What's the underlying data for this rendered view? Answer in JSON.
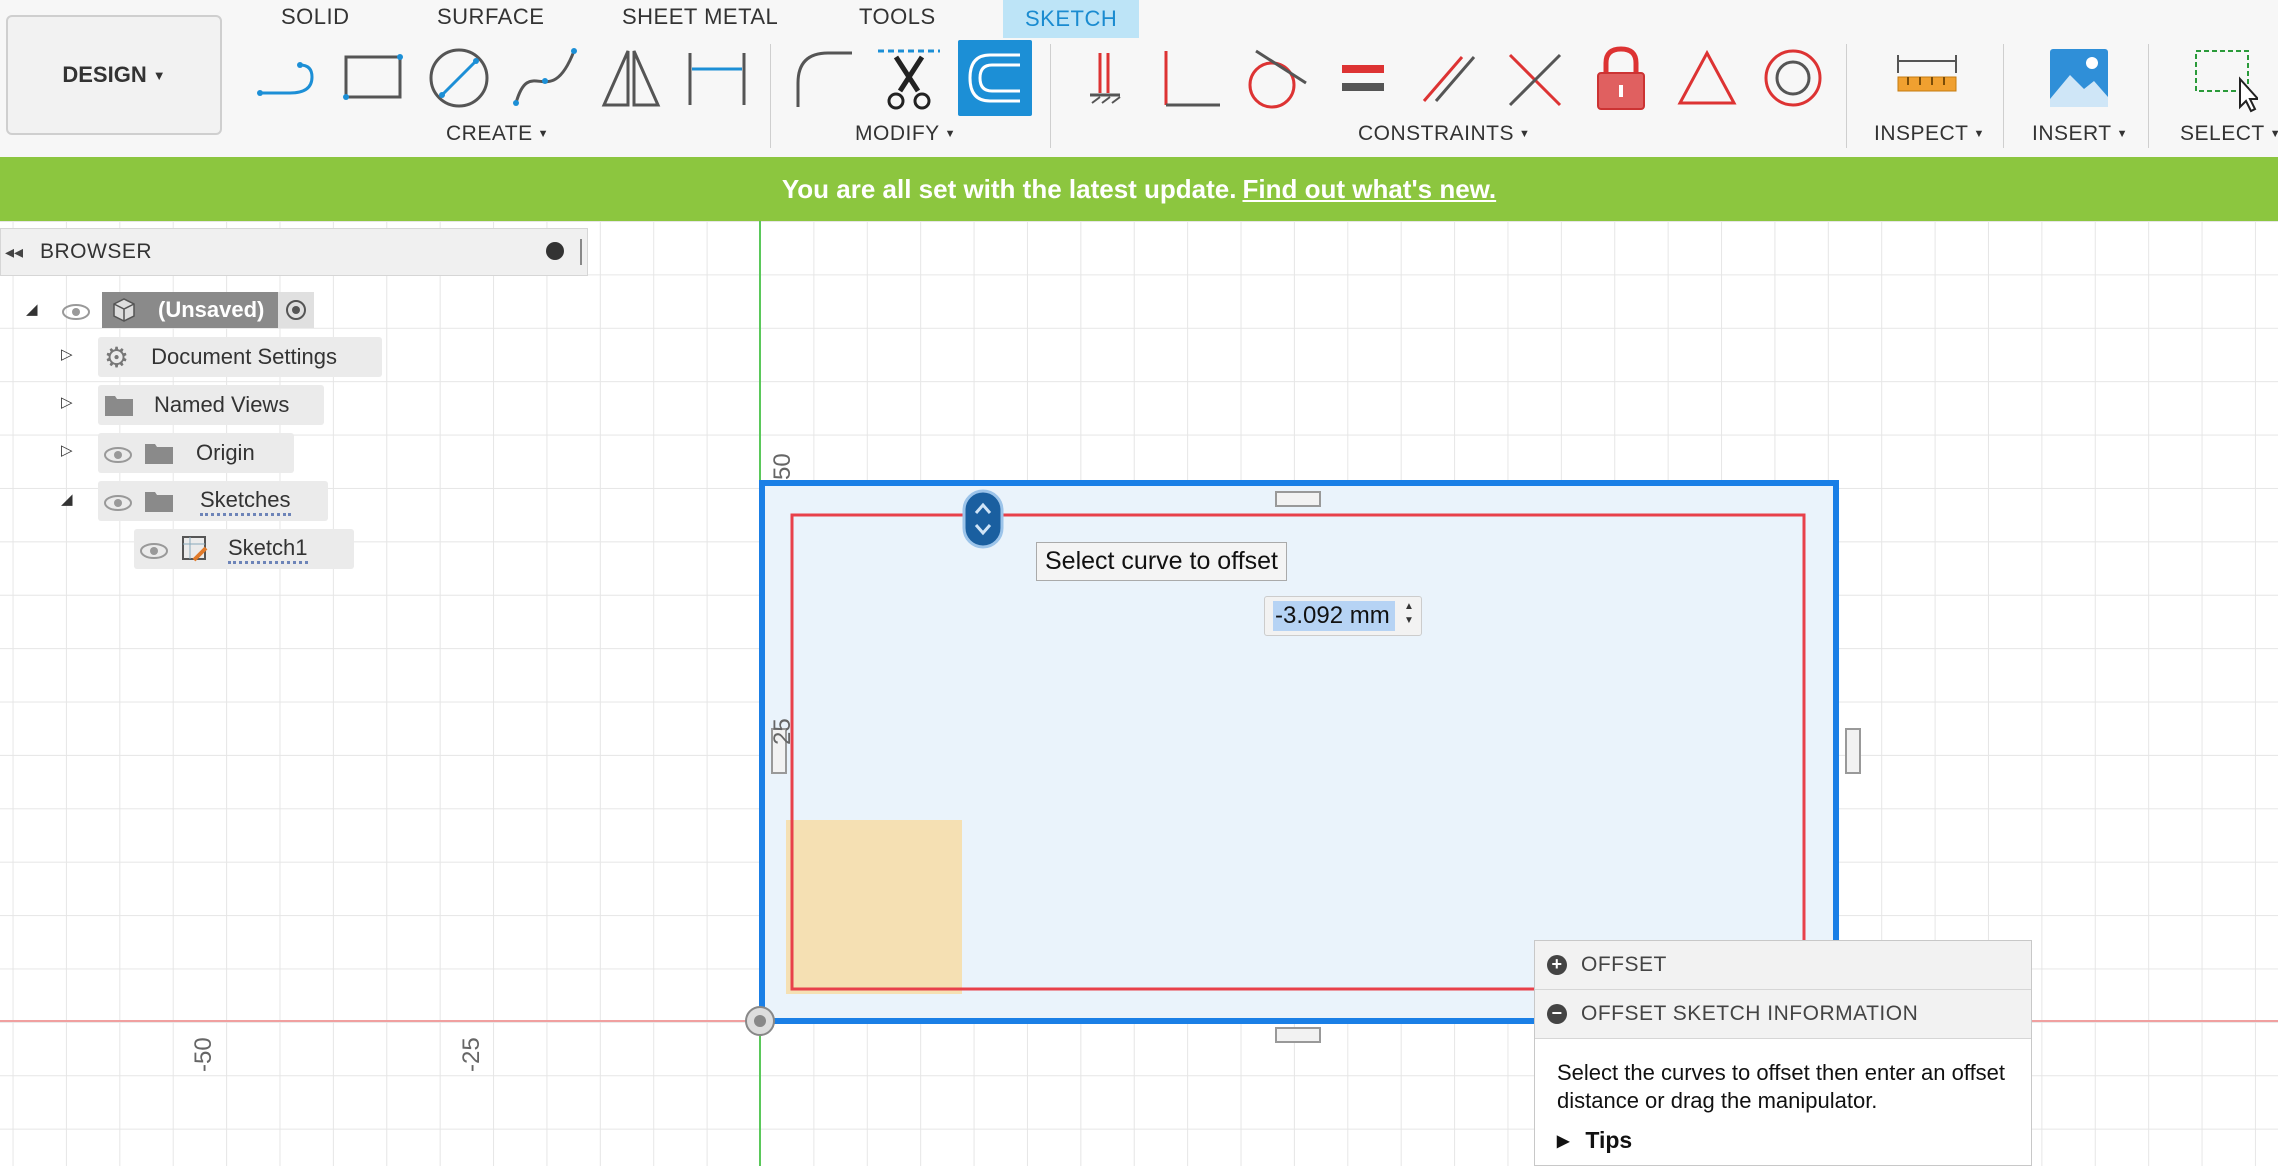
{
  "workspace": {
    "label": "DESIGN"
  },
  "tabs": [
    {
      "label": "SOLID"
    },
    {
      "label": "SURFACE"
    },
    {
      "label": "SHEET METAL"
    },
    {
      "label": "TOOLS"
    },
    {
      "label": "SKETCH",
      "active": true
    }
  ],
  "groups": {
    "create": "CREATE",
    "modify": "MODIFY",
    "constraints": "CONSTRAINTS",
    "inspect": "INSPECT",
    "insert": "INSERT",
    "select": "SELECT"
  },
  "banner": {
    "text": "You are all set with the latest update.",
    "link": "Find out what's new."
  },
  "browser": {
    "title": "BROWSER",
    "items": [
      {
        "label": "(Unsaved)",
        "icon": "component-icon"
      },
      {
        "label": "Document Settings",
        "icon": "gear-icon"
      },
      {
        "label": "Named Views",
        "icon": "folder-icon"
      },
      {
        "label": "Origin",
        "icon": "folder-icon"
      },
      {
        "label": "Sketches",
        "icon": "folder-icon"
      },
      {
        "label": "Sketch1",
        "icon": "sketch-icon"
      }
    ]
  },
  "canvas": {
    "axis_labels": {
      "y_top": "50",
      "y_mid": "25",
      "x_left": "-50",
      "x_mid": "-25"
    },
    "tooltip": "Select curve to offset",
    "offset_value": "-3.092 mm"
  },
  "panel": {
    "header": "OFFSET",
    "section": "OFFSET SKETCH INFORMATION",
    "description": "Select the curves to offset then enter an offset distance or drag the manipulator.",
    "tips": "Tips"
  },
  "colors": {
    "accent": "#1c8fd6",
    "banner": "#8cc63f",
    "outline": "#1a7fe6",
    "offset_curve": "#e8404a",
    "x_axis": "#e8404a",
    "y_axis": "#5ac85a"
  }
}
